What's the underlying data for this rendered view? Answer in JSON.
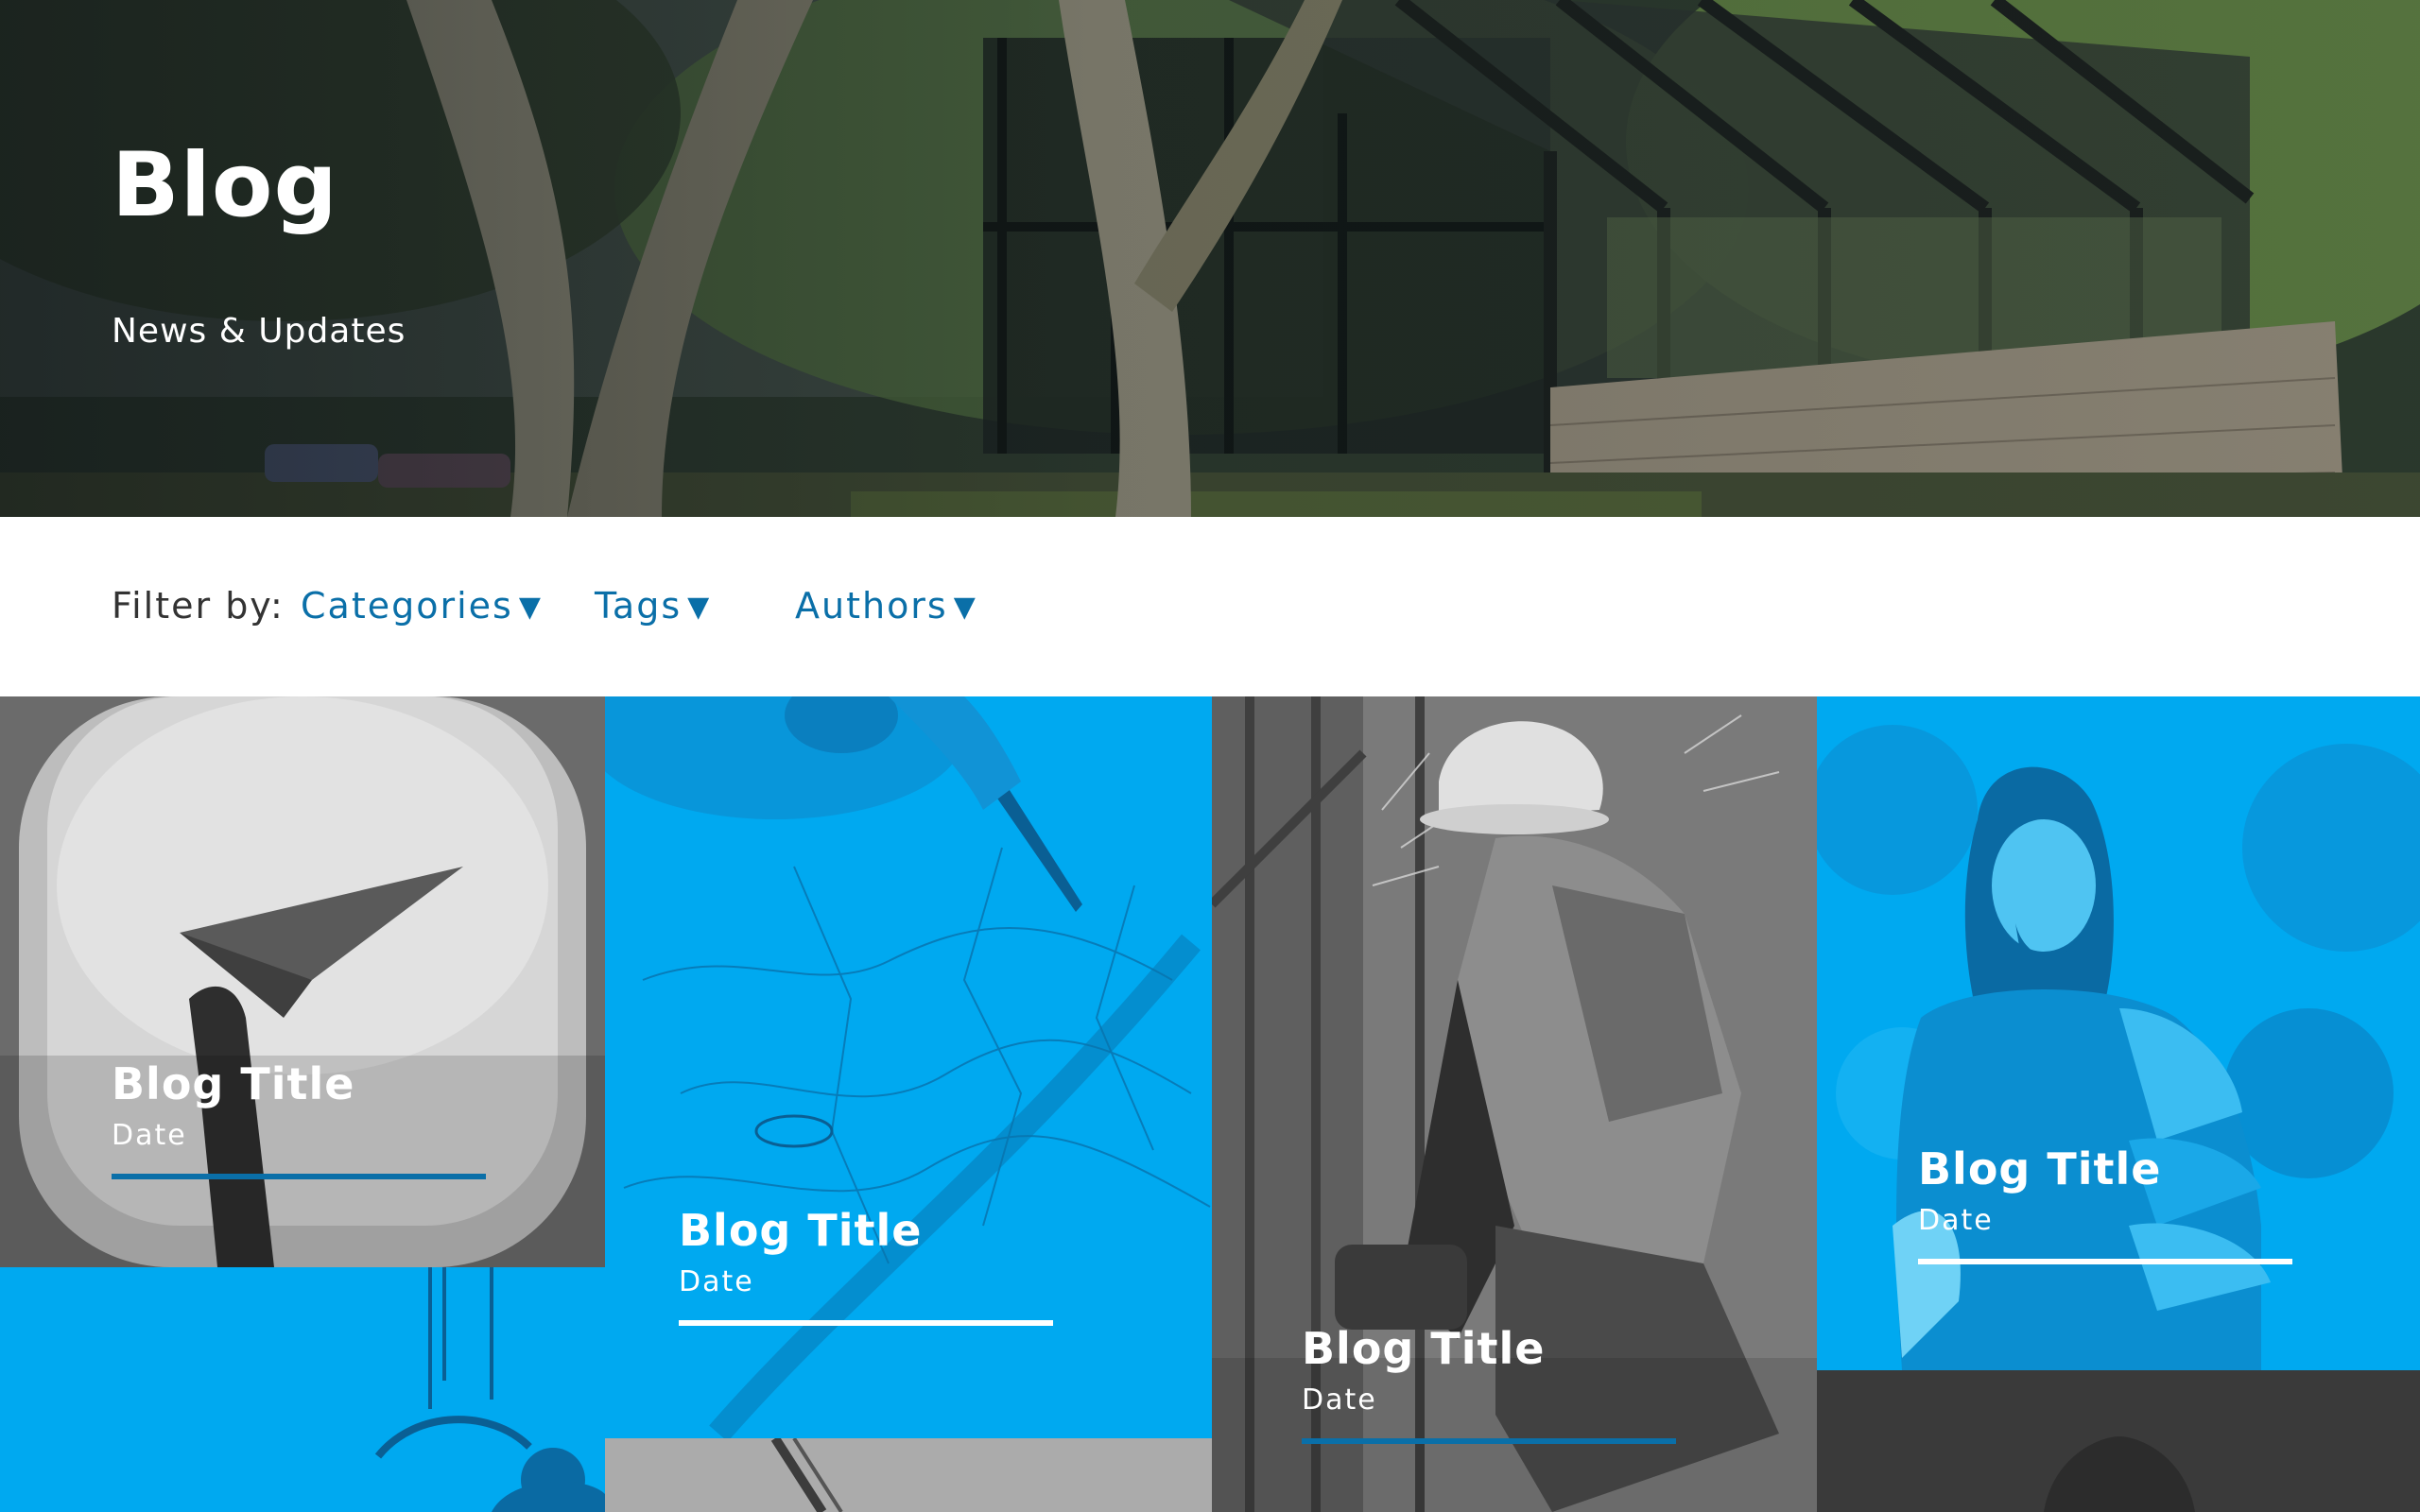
{
  "hero": {
    "title": "Blog",
    "subtitle": "News & Updates"
  },
  "filter": {
    "label": "Filter by:",
    "options": [
      {
        "label": "Categories",
        "caret": "▼"
      },
      {
        "label": "Tags",
        "caret": "▼"
      },
      {
        "label": "Authors",
        "caret": "▼"
      }
    ]
  },
  "colors": {
    "accent_blue": "#00a9f0",
    "link_blue": "#0a6fa8",
    "underline_blue": "#0a6fa8",
    "gray_tile": "#8f8f8f",
    "dark_tile": "#3a3a3a"
  },
  "cards": [
    {
      "title": "Blog Title",
      "date": "Date",
      "theme": "gray",
      "image": "paper-airplane-window"
    },
    {
      "title": "Blog Title",
      "date": "Date",
      "theme": "blue",
      "image": "map-with-pen"
    },
    {
      "title": "Blog Title",
      "date": "Date",
      "theme": "gray",
      "image": "welder-grinding"
    },
    {
      "title": "Blog Title",
      "date": "Date",
      "theme": "blue",
      "image": "knight-chainmail"
    }
  ],
  "partial_tiles": [
    {
      "theme": "blue",
      "image": "kitesurfer"
    },
    {
      "theme": "gray",
      "image": "climbing-rope"
    },
    {
      "theme": "dark",
      "image": "arch-silhouette"
    }
  ]
}
